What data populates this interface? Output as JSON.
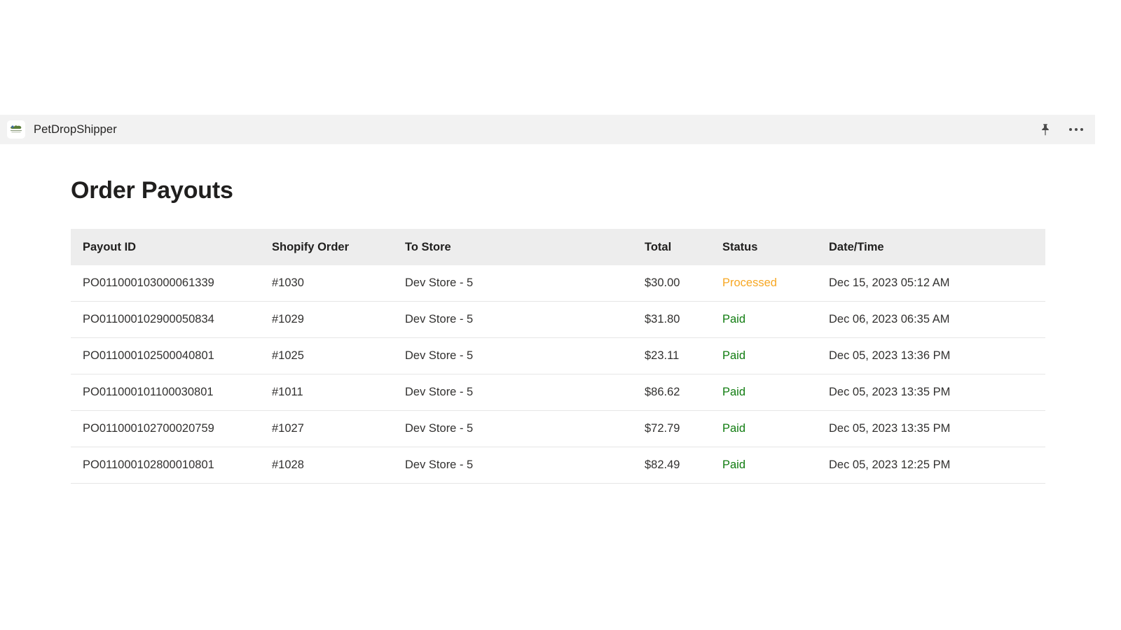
{
  "app_bar": {
    "title": "PetDropShipper",
    "logo_icon": "petdropshipper-logo-icon",
    "pin_icon": "pin-icon",
    "more_icon": "more-options-icon"
  },
  "page": {
    "title": "Order Payouts"
  },
  "table": {
    "columns": [
      "Payout ID",
      "Shopify Order",
      "To Store",
      "Total",
      "Status",
      "Date/Time"
    ],
    "status_colors": {
      "Paid": "#107c10",
      "Processed": "#f7a723"
    },
    "rows": [
      {
        "payout_id": "PO011000103000061339",
        "shopify_order": "#1030",
        "to_store": "Dev Store - 5",
        "total": "$30.00",
        "status": "Processed",
        "datetime": "Dec 15, 2023 05:12 AM"
      },
      {
        "payout_id": "PO011000102900050834",
        "shopify_order": "#1029",
        "to_store": "Dev Store - 5",
        "total": "$31.80",
        "status": "Paid",
        "datetime": "Dec 06, 2023 06:35 AM"
      },
      {
        "payout_id": "PO011000102500040801",
        "shopify_order": "#1025",
        "to_store": "Dev Store - 5",
        "total": "$23.11",
        "status": "Paid",
        "datetime": "Dec 05, 2023 13:36 PM"
      },
      {
        "payout_id": "PO011000101100030801",
        "shopify_order": "#1011",
        "to_store": "Dev Store - 5",
        "total": "$86.62",
        "status": "Paid",
        "datetime": "Dec 05, 2023 13:35 PM"
      },
      {
        "payout_id": "PO011000102700020759",
        "shopify_order": "#1027",
        "to_store": "Dev Store - 5",
        "total": "$72.79",
        "status": "Paid",
        "datetime": "Dec 05, 2023 13:35 PM"
      },
      {
        "payout_id": "PO011000102800010801",
        "shopify_order": "#1028",
        "to_store": "Dev Store - 5",
        "total": "$82.49",
        "status": "Paid",
        "datetime": "Dec 05, 2023 12:25 PM"
      }
    ]
  }
}
